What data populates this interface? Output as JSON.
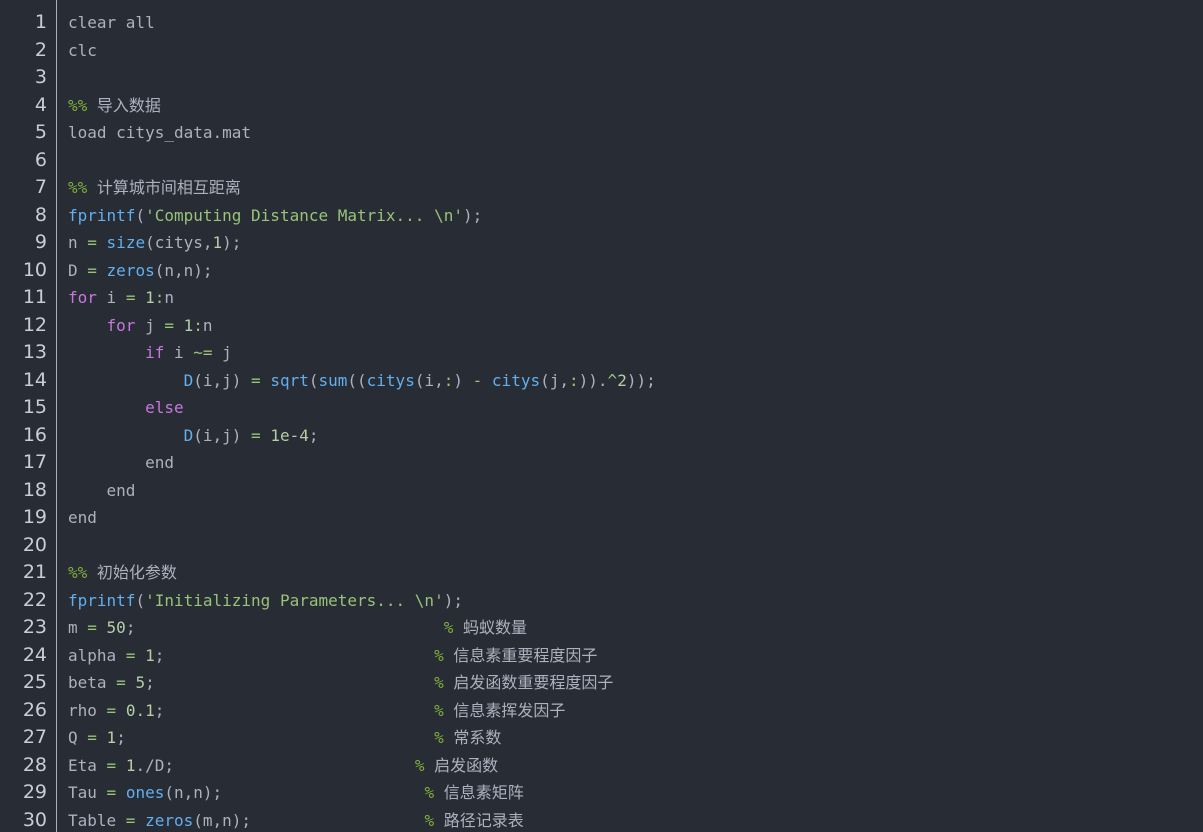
{
  "editor": {
    "colors": {
      "background": "#282c34",
      "text": "#abb2bf",
      "keyword": "#c678dd",
      "function": "#61afef",
      "string": "#98c379",
      "number": "#b5cea8",
      "comment_marker": "#7fb03a"
    },
    "lines": [
      {
        "n": "1",
        "tokens": [
          {
            "t": "clear all",
            "c": ""
          }
        ]
      },
      {
        "n": "2",
        "tokens": [
          {
            "t": "clc",
            "c": ""
          }
        ]
      },
      {
        "n": "3",
        "tokens": []
      },
      {
        "n": "4",
        "tokens": [
          {
            "t": "%% ",
            "c": "cm"
          },
          {
            "t": "导入数据",
            "c": "cmt"
          }
        ]
      },
      {
        "n": "5",
        "tokens": [
          {
            "t": "load citys_data.mat",
            "c": ""
          }
        ]
      },
      {
        "n": "6",
        "tokens": []
      },
      {
        "n": "7",
        "tokens": [
          {
            "t": "%% ",
            "c": "cm"
          },
          {
            "t": "计算城市间相互距离",
            "c": "cmt"
          }
        ]
      },
      {
        "n": "8",
        "tokens": [
          {
            "t": "fprintf",
            "c": "fn"
          },
          {
            "t": "(",
            "c": ""
          },
          {
            "t": "'Computing Distance Matrix... \\n'",
            "c": "str"
          },
          {
            "t": ");",
            "c": ""
          }
        ]
      },
      {
        "n": "9",
        "tokens": [
          {
            "t": "n ",
            "c": ""
          },
          {
            "t": "=",
            "c": "str"
          },
          {
            "t": " ",
            "c": ""
          },
          {
            "t": "size",
            "c": "fn"
          },
          {
            "t": "(citys,",
            "c": ""
          },
          {
            "t": "1",
            "c": "num2"
          },
          {
            "t": ");",
            "c": ""
          }
        ]
      },
      {
        "n": "10",
        "tokens": [
          {
            "t": "D ",
            "c": ""
          },
          {
            "t": "=",
            "c": "str"
          },
          {
            "t": " ",
            "c": ""
          },
          {
            "t": "zeros",
            "c": "fn"
          },
          {
            "t": "(n,n);",
            "c": ""
          }
        ]
      },
      {
        "n": "11",
        "tokens": [
          {
            "t": "for",
            "c": "kw"
          },
          {
            "t": " i ",
            "c": ""
          },
          {
            "t": "=",
            "c": "str"
          },
          {
            "t": " ",
            "c": ""
          },
          {
            "t": "1",
            "c": "num2"
          },
          {
            "t": ":",
            "c": "str"
          },
          {
            "t": "n",
            "c": ""
          }
        ]
      },
      {
        "n": "12",
        "tokens": [
          {
            "t": "    ",
            "c": ""
          },
          {
            "t": "for",
            "c": "kw"
          },
          {
            "t": " j ",
            "c": ""
          },
          {
            "t": "=",
            "c": "str"
          },
          {
            "t": " ",
            "c": ""
          },
          {
            "t": "1",
            "c": "num2"
          },
          {
            "t": ":",
            "c": "str"
          },
          {
            "t": "n",
            "c": ""
          }
        ]
      },
      {
        "n": "13",
        "tokens": [
          {
            "t": "        ",
            "c": ""
          },
          {
            "t": "if",
            "c": "kw"
          },
          {
            "t": " i ",
            "c": ""
          },
          {
            "t": "~=",
            "c": "str"
          },
          {
            "t": " j",
            "c": ""
          }
        ]
      },
      {
        "n": "14",
        "tokens": [
          {
            "t": "            ",
            "c": ""
          },
          {
            "t": "D",
            "c": "fn"
          },
          {
            "t": "(i,j) ",
            "c": ""
          },
          {
            "t": "=",
            "c": "str"
          },
          {
            "t": " ",
            "c": ""
          },
          {
            "t": "sqrt",
            "c": "fn"
          },
          {
            "t": "(",
            "c": ""
          },
          {
            "t": "sum",
            "c": "fn"
          },
          {
            "t": "((",
            "c": ""
          },
          {
            "t": "citys",
            "c": "fn"
          },
          {
            "t": "(i,",
            "c": ""
          },
          {
            "t": ":",
            "c": "str"
          },
          {
            "t": ") ",
            "c": ""
          },
          {
            "t": "-",
            "c": "str"
          },
          {
            "t": " ",
            "c": ""
          },
          {
            "t": "citys",
            "c": "fn"
          },
          {
            "t": "(j,",
            "c": ""
          },
          {
            "t": ":",
            "c": "str"
          },
          {
            "t": ")).",
            "c": ""
          },
          {
            "t": "^",
            "c": "str"
          },
          {
            "t": "2",
            "c": "num2"
          },
          {
            "t": "));",
            "c": ""
          }
        ]
      },
      {
        "n": "15",
        "tokens": [
          {
            "t": "        ",
            "c": ""
          },
          {
            "t": "else",
            "c": "kw"
          }
        ]
      },
      {
        "n": "16",
        "tokens": [
          {
            "t": "            ",
            "c": ""
          },
          {
            "t": "D",
            "c": "fn"
          },
          {
            "t": "(i,j) ",
            "c": ""
          },
          {
            "t": "=",
            "c": "str"
          },
          {
            "t": " ",
            "c": ""
          },
          {
            "t": "1e-4",
            "c": "num2"
          },
          {
            "t": ";",
            "c": ""
          }
        ]
      },
      {
        "n": "17",
        "tokens": [
          {
            "t": "        end",
            "c": ""
          }
        ]
      },
      {
        "n": "18",
        "tokens": [
          {
            "t": "    end",
            "c": ""
          }
        ]
      },
      {
        "n": "19",
        "tokens": [
          {
            "t": "end",
            "c": ""
          }
        ]
      },
      {
        "n": "20",
        "tokens": []
      },
      {
        "n": "21",
        "tokens": [
          {
            "t": "%% ",
            "c": "cm"
          },
          {
            "t": "初始化参数",
            "c": "cmt"
          }
        ]
      },
      {
        "n": "22",
        "tokens": [
          {
            "t": "fprintf",
            "c": "fn"
          },
          {
            "t": "(",
            "c": ""
          },
          {
            "t": "'Initializing Parameters... \\n'",
            "c": "str"
          },
          {
            "t": ");",
            "c": ""
          }
        ]
      },
      {
        "n": "23",
        "tokens": [
          {
            "t": "m ",
            "c": ""
          },
          {
            "t": "=",
            "c": "str"
          },
          {
            "t": " ",
            "c": ""
          },
          {
            "t": "50",
            "c": "num2"
          },
          {
            "t": ";                                ",
            "c": ""
          },
          {
            "t": "% ",
            "c": "cm"
          },
          {
            "t": "蚂蚁数量",
            "c": "cmt"
          }
        ]
      },
      {
        "n": "24",
        "tokens": [
          {
            "t": "alpha ",
            "c": ""
          },
          {
            "t": "=",
            "c": "str"
          },
          {
            "t": " ",
            "c": ""
          },
          {
            "t": "1",
            "c": "num2"
          },
          {
            "t": ";                            ",
            "c": ""
          },
          {
            "t": "% ",
            "c": "cm"
          },
          {
            "t": "信息素重要程度因子",
            "c": "cmt"
          }
        ]
      },
      {
        "n": "25",
        "tokens": [
          {
            "t": "beta ",
            "c": ""
          },
          {
            "t": "=",
            "c": "str"
          },
          {
            "t": " ",
            "c": ""
          },
          {
            "t": "5",
            "c": "num2"
          },
          {
            "t": ";                             ",
            "c": ""
          },
          {
            "t": "% ",
            "c": "cm"
          },
          {
            "t": "启发函数重要程度因子",
            "c": "cmt"
          }
        ]
      },
      {
        "n": "26",
        "tokens": [
          {
            "t": "rho ",
            "c": ""
          },
          {
            "t": "=",
            "c": "str"
          },
          {
            "t": " ",
            "c": ""
          },
          {
            "t": "0.1",
            "c": "num2"
          },
          {
            "t": ";                            ",
            "c": ""
          },
          {
            "t": "% ",
            "c": "cm"
          },
          {
            "t": "信息素挥发因子",
            "c": "cmt"
          }
        ]
      },
      {
        "n": "27",
        "tokens": [
          {
            "t": "Q ",
            "c": ""
          },
          {
            "t": "=",
            "c": "str"
          },
          {
            "t": " ",
            "c": ""
          },
          {
            "t": "1",
            "c": "num2"
          },
          {
            "t": ";                                ",
            "c": ""
          },
          {
            "t": "% ",
            "c": "cm"
          },
          {
            "t": "常系数",
            "c": "cmt"
          }
        ]
      },
      {
        "n": "28",
        "tokens": [
          {
            "t": "Eta ",
            "c": ""
          },
          {
            "t": "=",
            "c": "str"
          },
          {
            "t": " ",
            "c": ""
          },
          {
            "t": "1",
            "c": "num2"
          },
          {
            "t": "./D;                         ",
            "c": ""
          },
          {
            "t": "% ",
            "c": "cm"
          },
          {
            "t": "启发函数",
            "c": "cmt"
          }
        ]
      },
      {
        "n": "29",
        "tokens": [
          {
            "t": "Tau ",
            "c": ""
          },
          {
            "t": "=",
            "c": "str"
          },
          {
            "t": " ",
            "c": ""
          },
          {
            "t": "ones",
            "c": "fn"
          },
          {
            "t": "(n,n);                     ",
            "c": ""
          },
          {
            "t": "% ",
            "c": "cm"
          },
          {
            "t": "信息素矩阵",
            "c": "cmt"
          }
        ]
      },
      {
        "n": "30",
        "tokens": [
          {
            "t": "Table ",
            "c": ""
          },
          {
            "t": "=",
            "c": "str"
          },
          {
            "t": " ",
            "c": ""
          },
          {
            "t": "zeros",
            "c": "fn"
          },
          {
            "t": "(m,n);                  ",
            "c": ""
          },
          {
            "t": "% ",
            "c": "cm"
          },
          {
            "t": "路径记录表",
            "c": "cmt"
          }
        ]
      }
    ]
  }
}
